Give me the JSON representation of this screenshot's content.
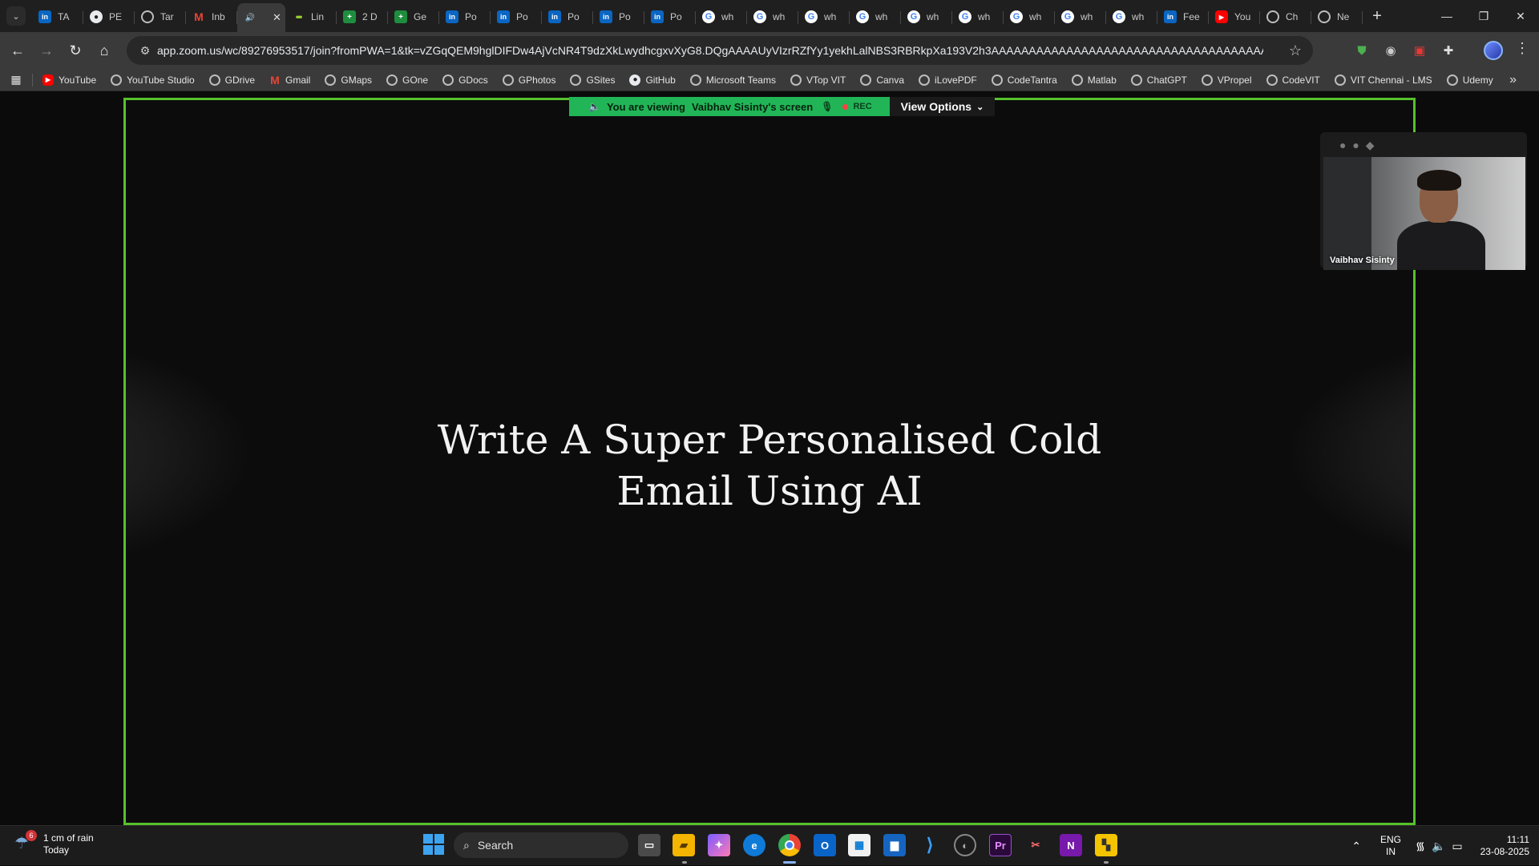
{
  "browser": {
    "tabs": [
      {
        "icon": "linkedin",
        "title": "TA"
      },
      {
        "icon": "github",
        "title": "PE"
      },
      {
        "icon": "globe",
        "title": "Tar"
      },
      {
        "icon": "gmail",
        "title": "Inb"
      },
      {
        "icon": "audio",
        "title": "",
        "active": true
      },
      {
        "icon": "lines",
        "title": "Lin"
      },
      {
        "icon": "sheets",
        "title": "2 D"
      },
      {
        "icon": "sheets",
        "title": "Ge"
      },
      {
        "icon": "linkedin",
        "title": "Po"
      },
      {
        "icon": "linkedin",
        "title": "Po"
      },
      {
        "icon": "linkedin",
        "title": "Po"
      },
      {
        "icon": "linkedin",
        "title": "Po"
      },
      {
        "icon": "linkedin",
        "title": "Po"
      },
      {
        "icon": "google",
        "title": "wh"
      },
      {
        "icon": "google",
        "title": "wh"
      },
      {
        "icon": "google",
        "title": "wh"
      },
      {
        "icon": "google",
        "title": "wh"
      },
      {
        "icon": "google",
        "title": "wh"
      },
      {
        "icon": "google",
        "title": "wh"
      },
      {
        "icon": "google",
        "title": "wh"
      },
      {
        "icon": "google",
        "title": "wh"
      },
      {
        "icon": "google",
        "title": "wh"
      },
      {
        "icon": "linkedin",
        "title": "Fee"
      },
      {
        "icon": "youtube",
        "title": "You"
      },
      {
        "icon": "globe",
        "title": "Ch"
      },
      {
        "icon": "globe",
        "title": "Ne"
      }
    ],
    "url": "app.zoom.us/wc/89276953517/join?fromPWA=1&tk=vZGqQEM9hglDIFDw4AjVcNR4T9dzXkLwydhcgxvXyG8.DQgAAAAUyVIzrRZfYy1yekhLalNBS3RBRkpXa193V2h3AAAAAAAAAAAAAAAAAAAAAAAAAAAAAAAAAAAAAAAA&_x_zm_r...",
    "bookmarks": [
      {
        "icon": "youtube",
        "label": "YouTube"
      },
      {
        "icon": "globe",
        "label": "YouTube Studio"
      },
      {
        "icon": "globe",
        "label": "GDrive"
      },
      {
        "icon": "gmail",
        "label": "Gmail"
      },
      {
        "icon": "globe",
        "label": "GMaps"
      },
      {
        "icon": "globe",
        "label": "GOne"
      },
      {
        "icon": "globe",
        "label": "GDocs"
      },
      {
        "icon": "globe",
        "label": "GPhotos"
      },
      {
        "icon": "globe",
        "label": "GSites"
      },
      {
        "icon": "github",
        "label": "GitHub"
      },
      {
        "icon": "globe",
        "label": "Microsoft Teams"
      },
      {
        "icon": "globe",
        "label": "VTop VIT"
      },
      {
        "icon": "globe",
        "label": "Canva"
      },
      {
        "icon": "globe",
        "label": "iLovePDF"
      },
      {
        "icon": "globe",
        "label": "CodeTantra"
      },
      {
        "icon": "globe",
        "label": "Matlab"
      },
      {
        "icon": "globe",
        "label": "ChatGPT"
      },
      {
        "icon": "globe",
        "label": "VPropel"
      },
      {
        "icon": "globe",
        "label": "CodeVIT"
      },
      {
        "icon": "globe",
        "label": "VIT Chennai - LMS"
      },
      {
        "icon": "globe",
        "label": "Udemy"
      }
    ]
  },
  "zoom": {
    "banner": {
      "prefix": "You are viewing",
      "presenter": "Vaibhav Sisinty's screen",
      "rec": "REC",
      "view_options": "View Options"
    },
    "slide": {
      "line1": "Write A Super Personalised Cold",
      "line2": "Email Using AI"
    },
    "participant": {
      "name": "Vaibhav Sisinty"
    },
    "share_border_color": "#56c22c"
  },
  "taskbar": {
    "weather": {
      "badge": "6",
      "line1": "1 cm of rain",
      "line2": "Today"
    },
    "search_placeholder": "Search",
    "language": {
      "line1": "ENG",
      "line2": "IN"
    },
    "clock": {
      "time": "11:11",
      "date": "23-08-2025"
    }
  }
}
